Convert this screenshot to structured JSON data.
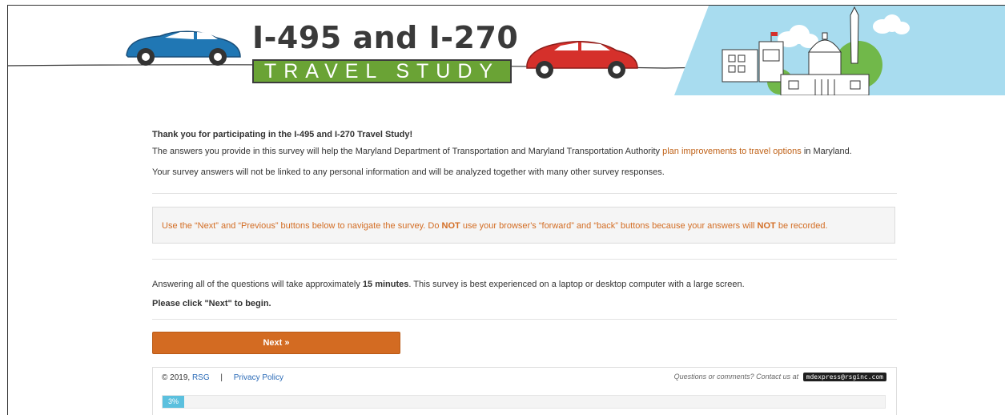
{
  "banner": {
    "title": "I-495 and I-270",
    "subtitle": "TRAVEL STUDY"
  },
  "intro": {
    "thanks": "Thank you for participating in the I-495 and I-270 Travel Study!",
    "purpose_before": "The answers you provide in this survey will help the Maryland Department of Transportation and Maryland Transportation Authority ",
    "purpose_link": "plan improvements to travel options",
    "purpose_after": " in Maryland.",
    "privacy": "Your survey answers will not be linked to any personal information and will be analyzed together with many other survey responses."
  },
  "notice": {
    "part1": "Use the “Next” and “Previous” buttons below to navigate the survey. Do ",
    "not1": "NOT",
    "part2": " use your browser's “forward” and “back” buttons because your answers will ",
    "not2": "NOT",
    "part3": " be recorded."
  },
  "duration": {
    "before": "Answering all of the questions will take approximately ",
    "minutes": "15 minutes",
    "after": ". This survey is best experienced on a laptop or desktop computer with a large screen."
  },
  "begin_prompt": "Please click \"Next\" to begin.",
  "next_button": "Next »",
  "footer": {
    "copyright": "© 2019,",
    "company_link": "RSG",
    "separator": "|",
    "privacy_link": "Privacy Policy",
    "contact_text": "Questions or comments? Contact us at",
    "email": "mdexpress@rsginc.com"
  },
  "progress": {
    "label": "3%",
    "fraction": 0.03
  },
  "colors": {
    "accent_orange": "#d36b22",
    "link_orange": "#c06218",
    "link_blue": "#2a6ab7",
    "title_green": "#6aa335",
    "progress_blue": "#5bc0de",
    "car_blue": "#2077b4",
    "car_red": "#d5302b"
  }
}
